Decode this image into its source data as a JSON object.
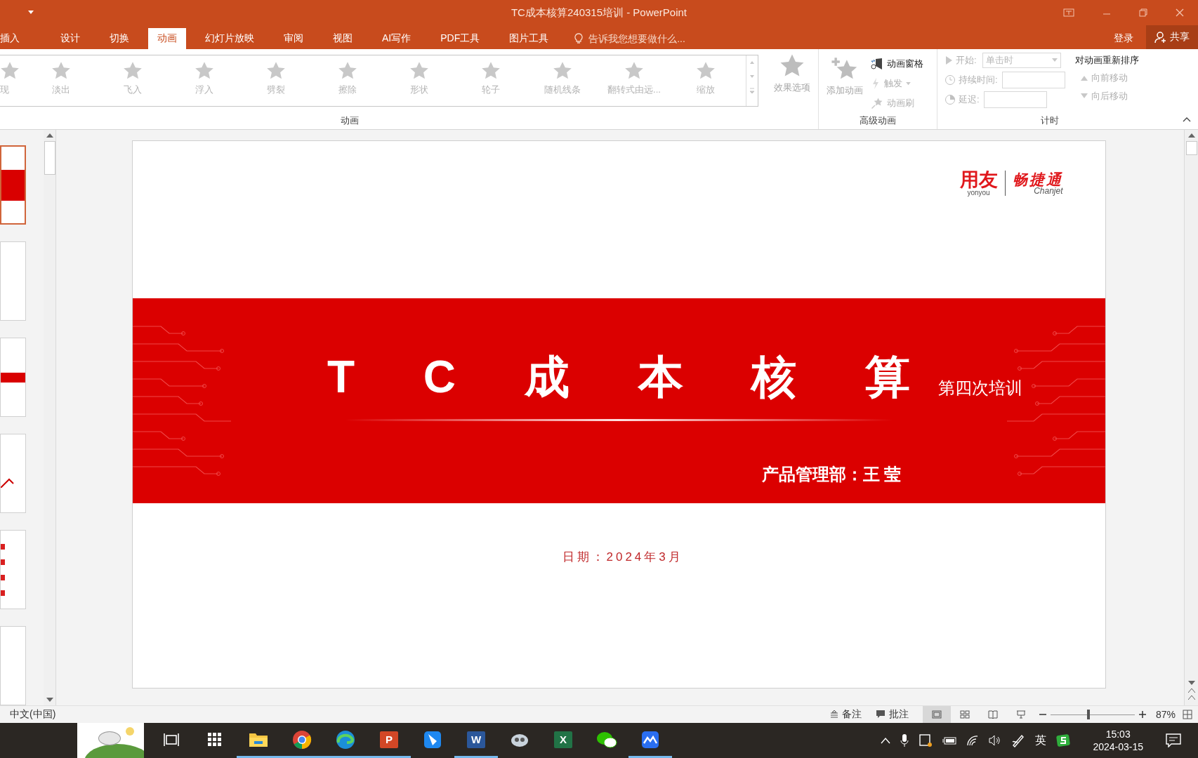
{
  "window": {
    "title": "TC成本核算240315培训 - PowerPoint"
  },
  "tabs": [
    {
      "label": "插入",
      "selected": false
    },
    {
      "label": "设计",
      "selected": false
    },
    {
      "label": "切换",
      "selected": false
    },
    {
      "label": "动画",
      "selected": true
    },
    {
      "label": "幻灯片放映",
      "selected": false
    },
    {
      "label": "审阅",
      "selected": false
    },
    {
      "label": "视图",
      "selected": false
    },
    {
      "label": "AI写作",
      "selected": false
    },
    {
      "label": "PDF工具",
      "selected": false
    },
    {
      "label": "图片工具",
      "selected": false
    }
  ],
  "tell_me": {
    "placeholder": "告诉我您想要做什么..."
  },
  "account": {
    "sign_in": "登录",
    "share": "共享"
  },
  "ribbon": {
    "gallery": [
      {
        "label": "现",
        "disabled": true
      },
      {
        "label": "淡出",
        "disabled": true
      },
      {
        "label": "飞入",
        "disabled": true
      },
      {
        "label": "浮入",
        "disabled": true
      },
      {
        "label": "劈裂",
        "disabled": true
      },
      {
        "label": "擦除",
        "disabled": true
      },
      {
        "label": "形状",
        "disabled": true
      },
      {
        "label": "轮子",
        "disabled": true
      },
      {
        "label": "随机线条",
        "disabled": true
      },
      {
        "label": "翻转式由远...",
        "disabled": true
      },
      {
        "label": "缩放",
        "disabled": true
      }
    ],
    "effect_options": {
      "label": "效果选项",
      "disabled": true
    },
    "animation_group": "动画",
    "add_animation": {
      "label": "添加动画",
      "disabled": true
    },
    "animation_pane": {
      "label": "动画窗格",
      "disabled": false
    },
    "trigger": {
      "label": "触发",
      "disabled": true
    },
    "painter": {
      "label": "动画刷",
      "disabled": true
    },
    "advanced_group": "高级动画",
    "start": {
      "label": "开始:",
      "value": "单击时"
    },
    "duration": {
      "label": "持续时间:"
    },
    "delay": {
      "label": "延迟:"
    },
    "timing_group": "计时",
    "reorder": "对动画重新排序",
    "move_earlier": {
      "label": "向前移动",
      "disabled": true
    },
    "move_later": {
      "label": "向后移动",
      "disabled": true
    }
  },
  "thumbnails": [
    {
      "kind": "title",
      "selected": true
    },
    {
      "kind": "blank",
      "selected": false
    },
    {
      "kind": "band",
      "selected": false
    },
    {
      "kind": "chart",
      "selected": false
    },
    {
      "kind": "table",
      "selected": false
    },
    {
      "kind": "blank",
      "selected": false
    }
  ],
  "slide": {
    "logo": {
      "brand": "用友",
      "brand_sub": "yonyou",
      "product": "畅捷通",
      "product_sub": "Chanjet"
    },
    "title": "T C 成 本 核 算",
    "subtitle": "第四次培训",
    "presenter": "产品管理部：王 莹",
    "date": "日期：2024年3月"
  },
  "status_bar": {
    "language": "中文(中国)",
    "notes": "备注",
    "comments": "批注",
    "views": [
      {
        "kind": "normal",
        "selected": true
      },
      {
        "kind": "sorter",
        "selected": false
      },
      {
        "kind": "reading",
        "selected": false
      },
      {
        "kind": "show",
        "selected": false
      }
    ],
    "zoom": {
      "level": 0.45,
      "reading": "87%"
    }
  },
  "taskbar": {
    "apps": [
      {
        "kind": "task-view",
        "running": false
      },
      {
        "kind": "grid",
        "running": false
      },
      {
        "kind": "folder",
        "running": true
      },
      {
        "kind": "chrome",
        "running": true
      },
      {
        "kind": "edge",
        "running": true
      },
      {
        "kind": "powerpoint",
        "letter": "P",
        "running": true
      },
      {
        "kind": "feather",
        "running": false
      },
      {
        "kind": "word",
        "letter": "W",
        "running": true
      },
      {
        "kind": "robot",
        "running": false
      },
      {
        "kind": "excel",
        "letter": "X",
        "running": false
      },
      {
        "kind": "chat",
        "running": false
      },
      {
        "kind": "wave",
        "running": true
      }
    ],
    "input_method": "英",
    "time": "15:03",
    "date": "2024-03-15"
  }
}
